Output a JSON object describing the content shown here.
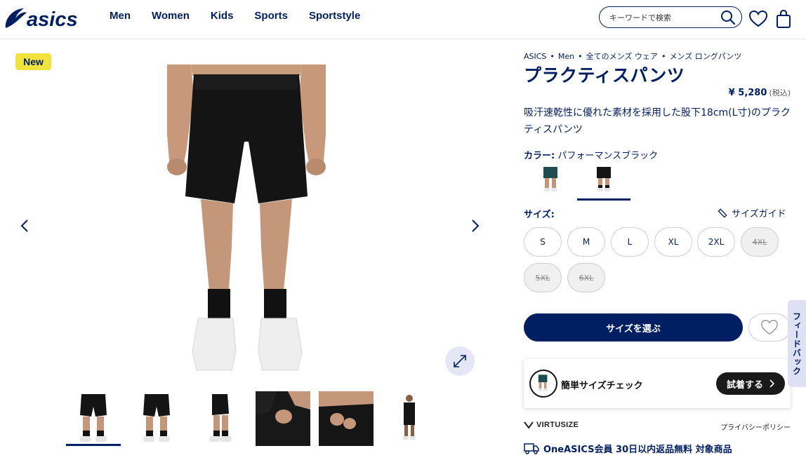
{
  "header": {
    "brand": "asics",
    "nav": [
      "Men",
      "Women",
      "Kids",
      "Sports",
      "Sportstyle"
    ],
    "search_placeholder": "キーワードで検索"
  },
  "gallery": {
    "badge": "New",
    "thumbnail_count": 6,
    "selected_thumbnail": 1
  },
  "product": {
    "breadcrumb": [
      "ASICS",
      "Men",
      "全てのメンズ ウェア",
      "メンズ ロングパンツ"
    ],
    "title": "プラクティスパンツ",
    "price": "¥ 5,280",
    "tax_note": "(税込)",
    "description": "吸汗速乾性に優れた素材を採用した股下18cm(L寸)のプラクティスパンツ",
    "color_label": "カラー:",
    "color_value": "パフォーマンスブラック",
    "swatches": [
      {
        "name": "green",
        "color": "#1e4d50"
      },
      {
        "name": "black",
        "color": "#141414"
      }
    ],
    "selected_swatch": 2,
    "size_label": "サイズ:",
    "size_guide": "サイズガイド",
    "sizes": [
      {
        "label": "S",
        "available": true
      },
      {
        "label": "M",
        "available": true
      },
      {
        "label": "L",
        "available": true
      },
      {
        "label": "XL",
        "available": true
      },
      {
        "label": "2XL",
        "available": true
      },
      {
        "label": "4XL",
        "available": false
      },
      {
        "label": "5XL",
        "available": false
      },
      {
        "label": "6XL",
        "available": false
      }
    ],
    "cta": "サイズを選ぶ"
  },
  "fitcheck": {
    "text": "簡単サイズチェック",
    "button": "試着する"
  },
  "virtusize": {
    "brand": "VIRTUSIZE",
    "privacy": "プライバシーポリシー"
  },
  "returns": "OneASICS会員 30日以内返品無料 対象商品",
  "feedback": "フィードバック",
  "colors": {
    "navy": "#001e62",
    "badge_yellow": "#f1e33b",
    "soft_blue": "#e6e7f5"
  }
}
